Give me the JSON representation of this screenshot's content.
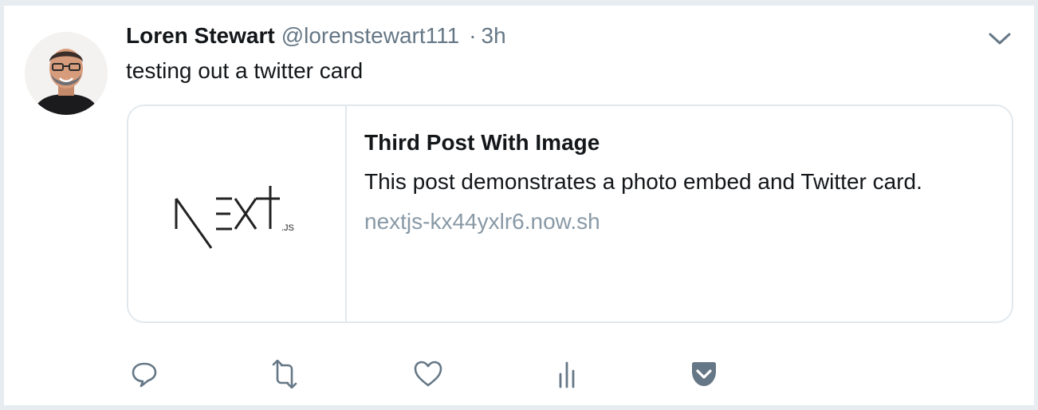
{
  "tweet": {
    "author_name": "Loren Stewart",
    "handle": "@lorenstewart111",
    "separator": "·",
    "time": "3h",
    "text": "testing out a twitter card",
    "avatar_icon": "avatar-photo",
    "more_icon": "chevron-down-icon"
  },
  "card": {
    "title": "Third Post With Image",
    "description": "This post demonstrates a photo embed and Twitter card.",
    "domain": "nextjs-kx44yxlr6.now.sh",
    "image_logo_text": "NEXT",
    "image_logo_suffix": ".JS"
  },
  "actions": [
    {
      "name": "reply",
      "icon": "reply-icon"
    },
    {
      "name": "retweet",
      "icon": "retweet-icon"
    },
    {
      "name": "like",
      "icon": "heart-icon"
    },
    {
      "name": "analytics",
      "icon": "analytics-icon"
    },
    {
      "name": "pocket",
      "icon": "pocket-icon"
    }
  ],
  "colors": {
    "text_primary": "#14171a",
    "text_secondary": "#657786",
    "domain_text": "#8899a6",
    "border": "#e1e8ed",
    "background": "#e6ecf0",
    "icon": "#657786",
    "pocket": "#657786"
  }
}
